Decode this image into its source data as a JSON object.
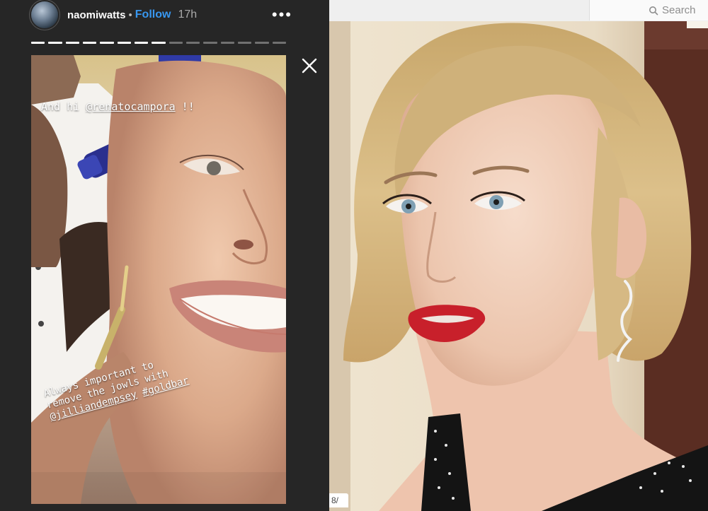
{
  "story": {
    "username": "naomiwatts",
    "dot": "•",
    "follow_label": "Follow",
    "time": "17h",
    "more_label": "•••",
    "progress": {
      "total": 15,
      "viewed": 8
    },
    "text_top_prefix": "And hi ",
    "text_top_mention": "@renatocampora",
    "text_top_suffix": " !!",
    "text_bottom_line1": "Always important to",
    "text_bottom_line2": "remove the jowls with",
    "text_bottom_mention1": "@jilliandempsey",
    "text_bottom_mention2": "#goldbar"
  },
  "photo": {
    "search_label": "Search",
    "page_counter": "8/"
  },
  "colors": {
    "follow": "#3897f0",
    "lip": "#c8202b",
    "hair": "#d7b982"
  }
}
